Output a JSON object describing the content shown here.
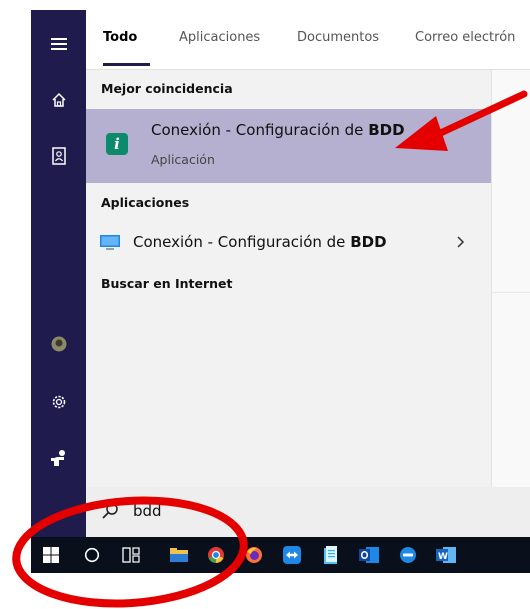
{
  "tabs": [
    "Todo",
    "Aplicaciones",
    "Documentos",
    "Correo electrón"
  ],
  "best_match": {
    "header": "Mejor coincidencia",
    "title_prefix": "Conexión - Configuración de ",
    "title_bold": "BDD",
    "subtitle": "Aplicación",
    "icon": "i"
  },
  "apps": {
    "header": "Aplicaciones",
    "item_prefix": "Conexión - Configuración de ",
    "item_bold": "BDD"
  },
  "web": {
    "header": "Buscar en Internet"
  },
  "search": {
    "value": "bdd"
  },
  "icons": {
    "rail": [
      "hamburger-icon",
      "home-icon",
      "contact-book-icon",
      "avatar",
      "gear-icon",
      "feedback-icon"
    ],
    "taskbar": [
      "windows-start-icon",
      "cortana-icon",
      "task-view-icon",
      "file-explorer-icon",
      "chrome-icon",
      "firefox-icon",
      "teamviewer-icon",
      "notepad-icon",
      "outlook-icon",
      "app-icon",
      "word-icon"
    ]
  },
  "colors": {
    "rail": "#1f1b4d",
    "highlight": "#b5b0cf",
    "annotation": "#e50000",
    "taskbar": "#0a0f1c"
  }
}
